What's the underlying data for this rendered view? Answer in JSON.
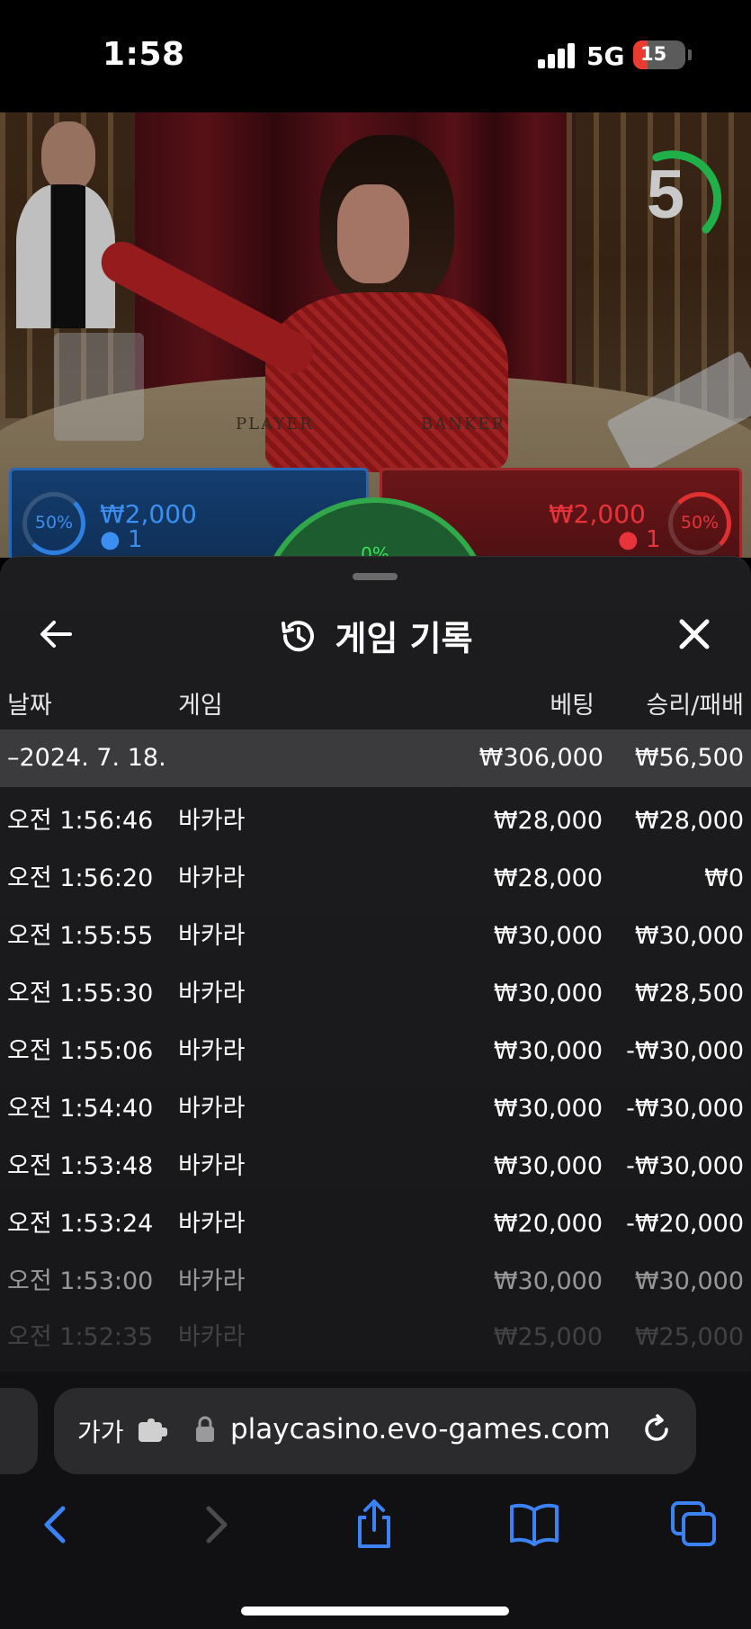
{
  "status_bar": {
    "time": "1:58",
    "network": "5G",
    "battery": "15"
  },
  "video": {
    "countdown": "5",
    "table_print_left": "PLAYER",
    "table_print_right": "BANKER",
    "player": {
      "percent": "50%",
      "amount": "₩2,000",
      "count": "1"
    },
    "banker": {
      "percent": "50%",
      "amount": "₩2,000",
      "count": "1"
    },
    "tie": {
      "percent": "0%"
    }
  },
  "sheet": {
    "title": "게임 기록",
    "columns": {
      "date": "날짜",
      "game": "게임",
      "bet": "베팅",
      "win_loss": "승리/패배"
    },
    "summary": {
      "date": "–2024. 7. 18.",
      "bet": "₩306,000",
      "win_loss": "₩56,500"
    },
    "rows": [
      {
        "time": "오전 1:56:46",
        "game": "바카라",
        "bet": "₩28,000",
        "win_loss": "₩28,000"
      },
      {
        "time": "오전 1:56:20",
        "game": "바카라",
        "bet": "₩28,000",
        "win_loss": "₩0"
      },
      {
        "time": "오전 1:55:55",
        "game": "바카라",
        "bet": "₩30,000",
        "win_loss": "₩30,000"
      },
      {
        "time": "오전 1:55:30",
        "game": "바카라",
        "bet": "₩30,000",
        "win_loss": "₩28,500"
      },
      {
        "time": "오전 1:55:06",
        "game": "바카라",
        "bet": "₩30,000",
        "win_loss": "-₩30,000"
      },
      {
        "time": "오전 1:54:40",
        "game": "바카라",
        "bet": "₩30,000",
        "win_loss": "-₩30,000"
      },
      {
        "time": "오전 1:53:48",
        "game": "바카라",
        "bet": "₩30,000",
        "win_loss": "-₩30,000"
      },
      {
        "time": "오전 1:53:24",
        "game": "바카라",
        "bet": "₩20,000",
        "win_loss": "-₩20,000"
      },
      {
        "time": "오전 1:53:00",
        "game": "바카라",
        "bet": "₩30,000",
        "win_loss": "₩30,000"
      },
      {
        "time": "오전 1:52:35",
        "game": "바카라",
        "bet": "₩25,000",
        "win_loss": "₩25,000"
      }
    ]
  },
  "browser": {
    "aa_label": "가가",
    "url": "playcasino.evo-games.com"
  },
  "colors": {
    "accent_blue": "#3b82f6",
    "player_blue": "#2a66b3",
    "banker_red": "#9c2a2c",
    "timer_green": "#1fb04a"
  }
}
